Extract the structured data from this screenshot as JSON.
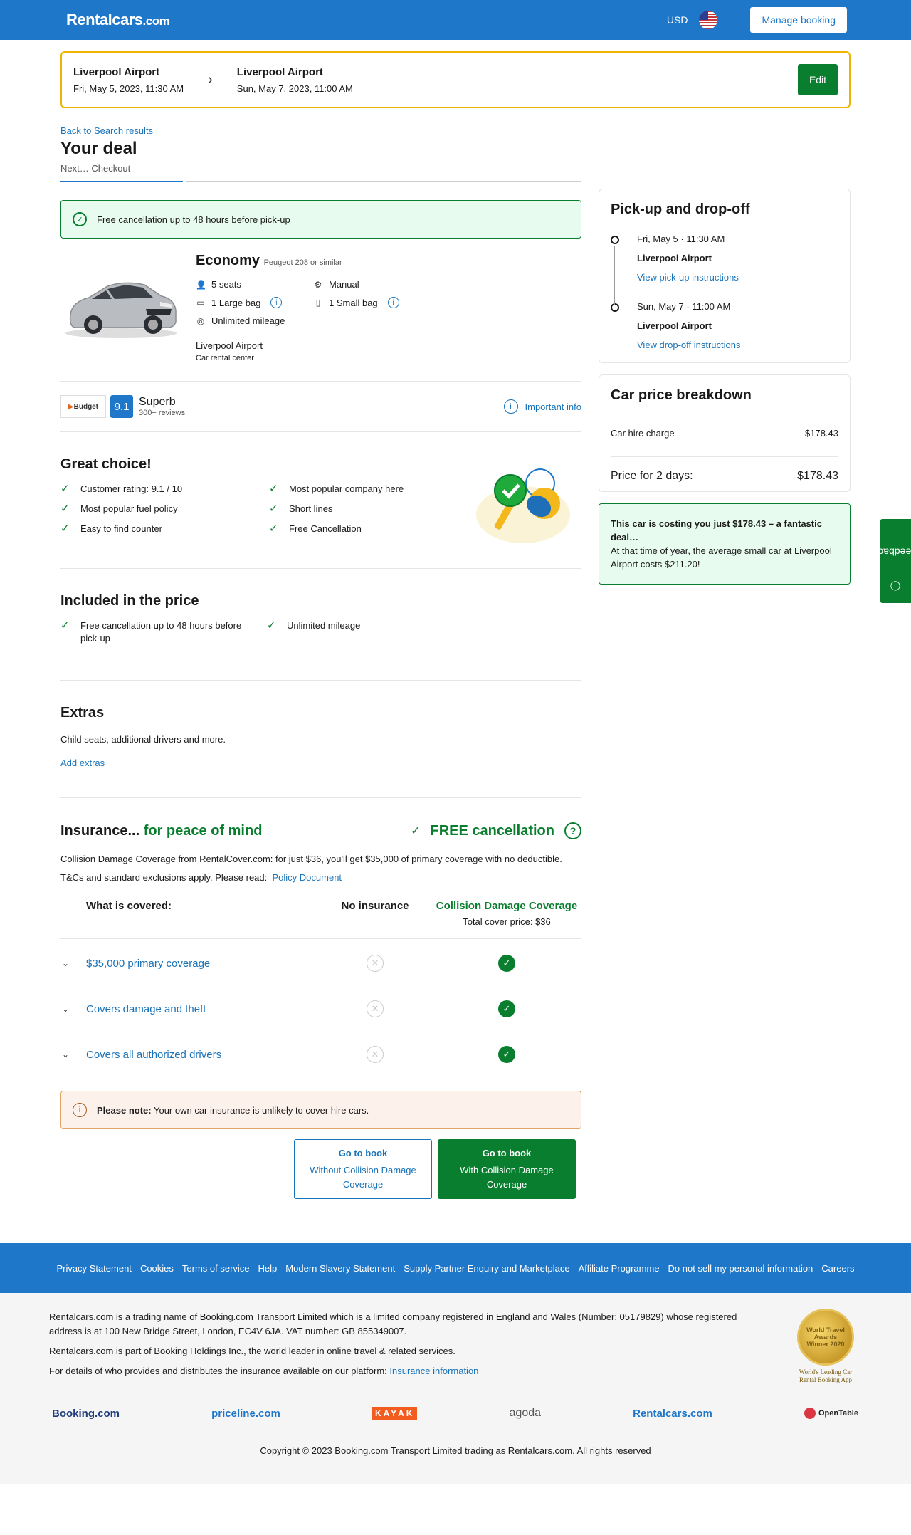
{
  "header": {
    "logo_main": "Rentalcars",
    "logo_suffix": ".com",
    "currency": "USD",
    "manage_booking": "Manage booking"
  },
  "search": {
    "pickup_location": "Liverpool Airport",
    "pickup_datetime": "Fri, May 5, 2023, 11:30 AM",
    "dropoff_location": "Liverpool Airport",
    "dropoff_datetime": "Sun, May 7, 2023, 11:00 AM",
    "edit_label": "Edit"
  },
  "page": {
    "back_link": "Back to Search results",
    "title": "Your deal",
    "step_label": "Next… Checkout"
  },
  "free_cancellation_banner": "Free cancellation up to 48 hours before pick-up",
  "car": {
    "category": "Economy",
    "model": "Peugeot 208 or similar",
    "specs": {
      "seats": "5 seats",
      "transmission": "Manual",
      "large_bag": "1 Large bag",
      "small_bag": "1 Small bag",
      "mileage": "Unlimited mileage"
    },
    "pickup_location": "Liverpool Airport",
    "pickup_type": "Car rental center"
  },
  "supplier": {
    "logo_text": "Budget",
    "score": "9.1",
    "rating_label": "Superb",
    "reviews": "300+ reviews",
    "important_info": "Important info"
  },
  "great_choice": {
    "title": "Great choice!",
    "items": [
      "Customer rating: 9.1 / 10",
      "Most popular company here",
      "Most popular fuel policy",
      "Short lines",
      "Easy to find counter",
      "Free Cancellation"
    ]
  },
  "included": {
    "title": "Included in the price",
    "items": [
      "Free cancellation up to 48 hours before pick-up",
      "Unlimited mileage"
    ]
  },
  "extras": {
    "title": "Extras",
    "description": "Child seats, additional drivers and more.",
    "add_label": "Add extras"
  },
  "insurance": {
    "title_main": "Insurance...",
    "title_accent": "for peace of mind",
    "free_cancellation": "FREE cancellation",
    "description": "Collision Damage Coverage from RentalCover.com: for just $36, you'll get $35,000 of primary coverage with no deductible.",
    "tc_text": "T&Cs and standard exclusions apply. Please read:",
    "policy_link": "Policy Document",
    "col_covered": "What is covered:",
    "col_none": "No insurance",
    "col_cdc": "Collision Damage Coverage",
    "col_cdc_price": "Total cover price: $36",
    "rows": [
      "$35,000 primary coverage",
      "Covers damage and theft",
      "Covers all authorized drivers"
    ],
    "note_bold": "Please note:",
    "note_text": "Your own car insurance is unlikely to cover hire cars."
  },
  "booking": {
    "without_title": "Go to book",
    "without_sub": "Without Collision Damage Coverage",
    "with_title": "Go to book",
    "with_sub": "With Collision Damage Coverage"
  },
  "sidebar": {
    "pickup_title": "Pick-up and drop-off",
    "pickup_date": "Fri, May 5 · 11:30 AM",
    "pickup_place": "Liverpool Airport",
    "pickup_link": "View pick-up instructions",
    "dropoff_date": "Sun, May 7 · 11:00 AM",
    "dropoff_place": "Liverpool Airport",
    "dropoff_link": "View drop-off instructions",
    "price_title": "Car price breakdown",
    "hire_label": "Car hire charge",
    "hire_value": "$178.43",
    "total_label": "Price for 2 days:",
    "total_value": "$178.43",
    "deal_bold": "This car is costing you just $178.43 – a fantastic deal…",
    "deal_text": "At that time of year, the average small car at Liverpool Airport costs $211.20!"
  },
  "feedback": "Feedback",
  "footer": {
    "links": [
      "Privacy Statement",
      "Cookies",
      "Terms of service",
      "Help",
      "Modern Slavery Statement",
      "Supply Partner Enquiry and Marketplace",
      "Affiliate Programme",
      "Do not sell my personal information",
      "Careers"
    ],
    "legal_1": "Rentalcars.com is a trading name of Booking.com Transport Limited which is a limited company registered in England and Wales (Number: 05179829) whose registered address is at 100 New Bridge Street, London, EC4V 6JA. VAT number: GB 855349007.",
    "legal_2": "Rentalcars.com is part of Booking Holdings Inc., the world leader in online travel & related services.",
    "legal_3": "For details of who provides and distributes the insurance available on our platform:",
    "insurance_link": "Insurance information",
    "award_line1": "World Travel Awards",
    "award_line2": "Winner 2020",
    "award_caption": "World's Leading Car Rental Booking App",
    "brands": [
      "Booking.com",
      "priceline.com",
      "KAYAK",
      "agoda",
      "Rentalcars.com",
      "OpenTable"
    ],
    "copyright": "Copyright © 2023 Booking.com Transport Limited trading as Rentalcars.com. All rights reserved"
  }
}
